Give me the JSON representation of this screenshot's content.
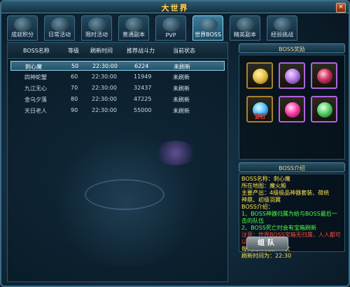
{
  "window": {
    "title": "大世界",
    "close_label": "×"
  },
  "tabs": [
    {
      "label": "成就积分",
      "icon": "scroll-icon",
      "active": false
    },
    {
      "label": "日常活动",
      "icon": "calendar-icon",
      "active": false
    },
    {
      "label": "限时活动",
      "icon": "hourglass-icon",
      "active": false
    },
    {
      "label": "普通副本",
      "icon": "gate-icon",
      "active": false
    },
    {
      "label": "PVP",
      "icon": "crossed-swords-icon",
      "active": false
    },
    {
      "label": "世界BOSS",
      "icon": "dragon-icon",
      "active": true
    },
    {
      "label": "精英副本",
      "icon": "castle-icon",
      "active": false
    },
    {
      "label": "经验挑战",
      "icon": "star-icon",
      "active": false
    }
  ],
  "boss_table": {
    "headers": [
      "BOSS名称",
      "等级",
      "刷新时间",
      "推荐战斗力",
      "当前状态"
    ],
    "rows": [
      {
        "name": "刺心魔",
        "level": "50",
        "time": "22:30:00",
        "power": "6224",
        "status": "未刷新",
        "selected": true
      },
      {
        "name": "四神蛇蟹",
        "level": "60",
        "time": "22:30:00",
        "power": "11949",
        "status": "未刷新",
        "selected": false
      },
      {
        "name": "九江无心",
        "level": "70",
        "time": "22:30:00",
        "power": "32437",
        "status": "未刷新",
        "selected": false
      },
      {
        "name": "金乌夕落",
        "level": "80",
        "time": "22:30:00",
        "power": "47225",
        "status": "未刷新",
        "selected": false
      },
      {
        "name": "天日老人",
        "level": "90",
        "time": "22:30:00",
        "power": "55000",
        "status": "未刷新",
        "selected": false
      }
    ]
  },
  "rewards": {
    "title": "BOSS奖励",
    "items": [
      {
        "icon": "gold-ingot-icon",
        "label": "",
        "color": "#e8c24a",
        "rarity": "gold"
      },
      {
        "icon": "purple-wing-icon",
        "label": "",
        "color": "#b57be8",
        "rarity": "purple"
      },
      {
        "icon": "dark-orb-icon",
        "label": "",
        "color": "#d83a6a",
        "rarity": "purple"
      },
      {
        "icon": "gem-icon",
        "label": "宝石",
        "color": "#4ec3ff",
        "rarity": "gold"
      },
      {
        "icon": "pink-crystal-icon",
        "label": "",
        "color": "#ff3fae",
        "rarity": "purple"
      },
      {
        "icon": "green-feather-icon",
        "label": "",
        "color": "#58d26a",
        "rarity": "purple"
      }
    ]
  },
  "intro": {
    "title": "BOSS介绍",
    "lines": [
      {
        "text": "BOSS名称：刺心魔",
        "color": "yellow"
      },
      {
        "text": "所在地图：魔火殿",
        "color": "yellow"
      },
      {
        "text": "主要产出：4级极品神器套装、荷统",
        "color": "yellow"
      },
      {
        "text": "神鼎、初级羽翼",
        "color": "yellow"
      },
      {
        "text": "BOSS介绍：",
        "color": "yellow"
      },
      {
        "text": "1、BOSS神器归属为给与BOSS最后一击的队伍",
        "color": "green"
      },
      {
        "text": "2、BOSS死亡时会有宝箱刷新",
        "color": "green"
      },
      {
        "text": "注意：世界BOSS宝箱无归属，人人都可以开启！",
        "color": "red"
      },
      {
        "text": "每天刷新次数：1次",
        "color": "yellow"
      },
      {
        "text": "刷新时间为：22:30",
        "color": "yellow"
      }
    ]
  },
  "action": {
    "label": "组队"
  }
}
